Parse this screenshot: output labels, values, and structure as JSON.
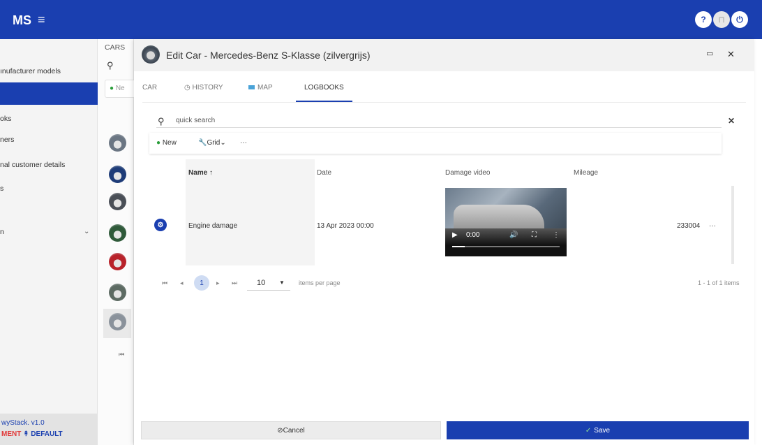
{
  "app": {
    "title": "MS"
  },
  "header_icons": {
    "help": "?",
    "user": "⊓",
    "power": "⏻"
  },
  "sidebar": {
    "items": [
      {
        "label": "ınufacturer models"
      },
      {
        "label": ""
      },
      {
        "label": "oks"
      },
      {
        "label": "ners"
      },
      {
        "label": "nal customer details"
      },
      {
        "label": "s"
      },
      {
        "label": "n"
      }
    ],
    "version": "wyStack. v1.0",
    "env_left": "MENT",
    "env_sep": "↟",
    "env_right": "DEFAULT"
  },
  "cars_list": {
    "header": "CARS",
    "new_label": "Ne",
    "avatar_colors": [
      "#6b7683",
      "#1e3c78",
      "#4a4f57",
      "#2f5a3a",
      "#b8222a",
      "#5d6b63",
      "#8a929b"
    ]
  },
  "modal": {
    "title": "Edit Car - Mercedes-Benz S-Klasse (zilvergrijs)",
    "tabs": [
      "CAR",
      "HISTORY",
      "MAP",
      "LOGBOOKS"
    ],
    "active_tab": "LOGBOOKS",
    "search_placeholder": "quick search",
    "toolbar": {
      "new_label": "New",
      "grid_label": "Grid",
      "more_label": "···"
    },
    "columns": {
      "name": "Name",
      "date": "Date",
      "damage_video": "Damage video",
      "mileage": "Mileage"
    },
    "rows": [
      {
        "name": "Engine damage",
        "date": "13 Apr 2023 00:00",
        "video_time": "0:00",
        "mileage": "233004",
        "more": "···"
      }
    ],
    "pager": {
      "current_page": "1",
      "page_size": "10",
      "items_per_page_label": "items per page",
      "range_label": "1 - 1 of 1 items"
    },
    "cancel_label": "Cancel",
    "save_label": "Save"
  }
}
